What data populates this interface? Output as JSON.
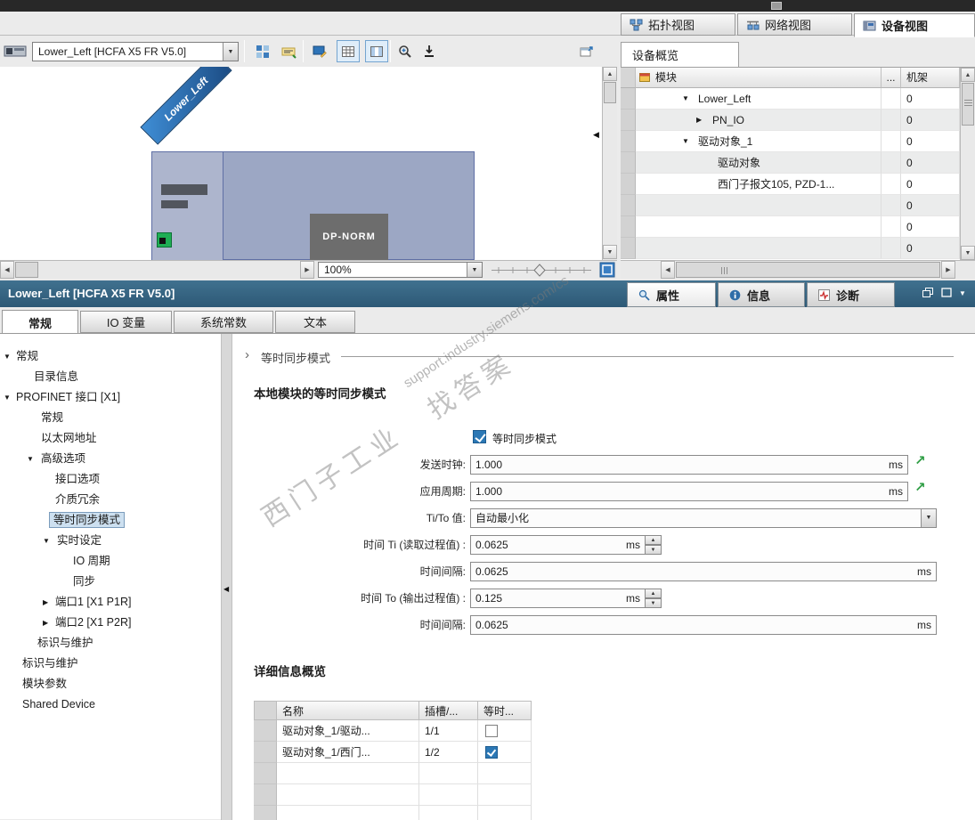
{
  "icons": {
    "caret_down": "▼",
    "caret_up": "▲",
    "caret_left": "◀",
    "caret_right": "▶",
    "chevron_right": "›",
    "green_arrow": "↗"
  },
  "view_tabs": {
    "topology": "拓扑视图",
    "network": "网络视图",
    "device": "设备视图"
  },
  "toolbar": {
    "device_selector": "Lower_Left [HCFA X5 FR V5.0]",
    "zoom_value": "100%"
  },
  "canvas": {
    "device_label": "Lower_Left",
    "dp_norm_label": "DP-NORM"
  },
  "overview": {
    "title": "设备概览",
    "col_module": "模块",
    "col_dots": "...",
    "col_rack": "机架",
    "rows": [
      {
        "name": "Lower_Left",
        "rack": "0"
      },
      {
        "name": "PN_IO",
        "rack": "0"
      },
      {
        "name": "驱动对象_1",
        "rack": "0"
      },
      {
        "name": "驱动对象",
        "rack": "0"
      },
      {
        "name": "西门子报文105, PZD-1...",
        "rack": "0"
      },
      {
        "name": "",
        "rack": "0"
      },
      {
        "name": "",
        "rack": "0"
      },
      {
        "name": "",
        "rack": "0"
      }
    ]
  },
  "inspector": {
    "title": "Lower_Left [HCFA X5 FR V5.0]",
    "tab_properties": "属性",
    "tab_info": "信息",
    "tab_diagnostics": "诊断",
    "subtab_general": "常规",
    "subtab_io": "IO 变量",
    "subtab_constants": "系统常数",
    "subtab_texts": "文本"
  },
  "nav": {
    "items": [
      {
        "label": "常规"
      },
      {
        "label": "目录信息"
      },
      {
        "label": "PROFINET 接口 [X1]"
      },
      {
        "label": "常规"
      },
      {
        "label": "以太网地址"
      },
      {
        "label": "高级选项"
      },
      {
        "label": "接口选项"
      },
      {
        "label": "介质冗余"
      },
      {
        "label": "等时同步模式"
      },
      {
        "label": "实时设定"
      },
      {
        "label": "IO 周期"
      },
      {
        "label": "同步"
      },
      {
        "label": "端口1 [X1 P1R]"
      },
      {
        "label": "端口2 [X1 P2R]"
      },
      {
        "label": "标识与维护"
      },
      {
        "label": "标识与维护"
      },
      {
        "label": "模块参数"
      },
      {
        "label": "Shared Device"
      }
    ]
  },
  "panel": {
    "breadcrumb": "等时同步模式",
    "section_heading": "本地模块的等时同步模式",
    "iso_checkbox_label": "等时同步模式",
    "send_clock_label": "发送时钟:",
    "send_clock_value": "1.000",
    "send_clock_unit": "ms",
    "app_cycle_label": "应用周期:",
    "app_cycle_value": "1.000",
    "app_cycle_unit": "ms",
    "tito_label": "Ti/To 值:",
    "tito_value": "自动最小化",
    "ti_label": "时间 Ti (读取过程值) :",
    "ti_value": "0.0625",
    "ti_unit": "ms",
    "interval1_label": "时间间隔:",
    "interval1_value": "0.0625",
    "interval1_unit": "ms",
    "to_label": "时间 To (输出过程值) :",
    "to_value": "0.125",
    "to_unit": "ms",
    "interval2_label": "时间间隔:",
    "interval2_value": "0.0625",
    "interval2_unit": "ms",
    "detail_heading": "详细信息概览",
    "detail": {
      "col_name": "名称",
      "col_slot": "插槽/...",
      "col_iso": "等时...",
      "rows": [
        {
          "name": "驱动对象_1/驱动...",
          "slot": "1/1",
          "isochronous": false
        },
        {
          "name": "驱动对象_1/西门...",
          "slot": "1/2",
          "isochronous": true
        }
      ]
    }
  },
  "watermark": {
    "brand": "西门子工业",
    "tagline": "找答案",
    "url": "support.industry.siemens.com/cs"
  }
}
